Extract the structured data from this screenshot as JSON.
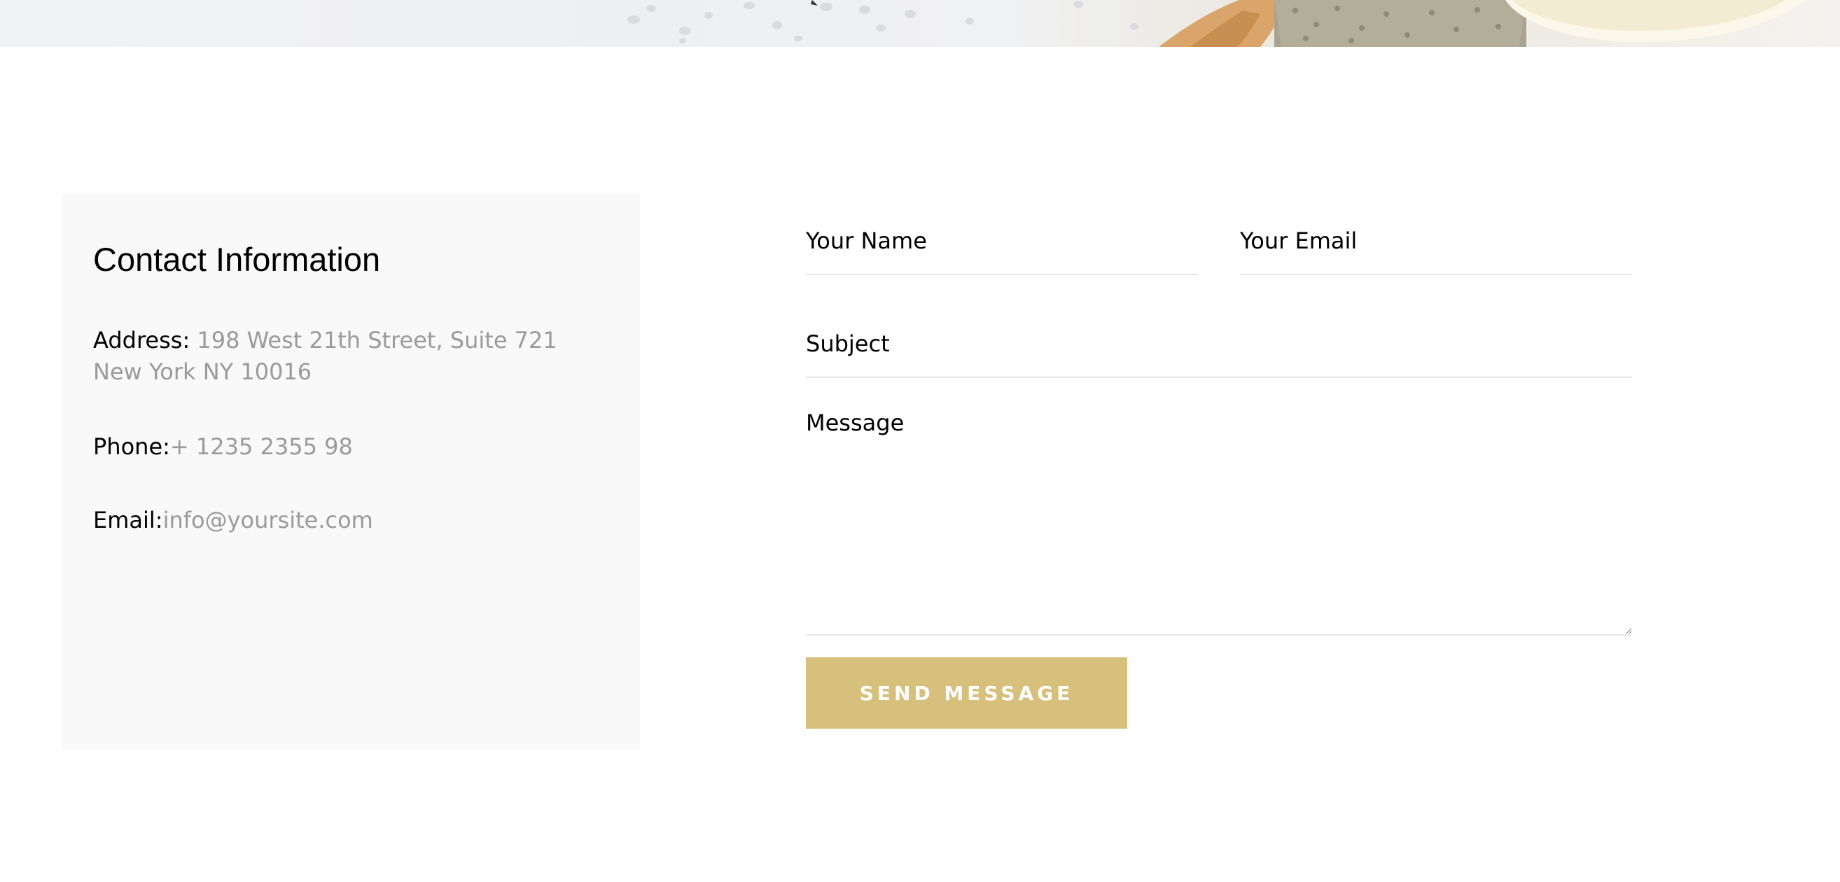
{
  "contact": {
    "title": "Contact Information",
    "address_label": "Address:",
    "address_value": " 198 West 21th Street, Suite 721 New York NY 10016",
    "phone_label": "Phone:",
    "phone_value": "+ 1235 2355 98",
    "email_label": "Email:",
    "email_value": "info@yoursite.com"
  },
  "form": {
    "name_placeholder": "Your Name",
    "email_placeholder": "Your Email",
    "subject_placeholder": "Subject",
    "message_placeholder": "Message",
    "send_label": "SEND MESSAGE"
  },
  "colors": {
    "accent": "#d6c07c",
    "panel_background": "#f9f9f9",
    "muted_text": "#9a9a9a"
  }
}
